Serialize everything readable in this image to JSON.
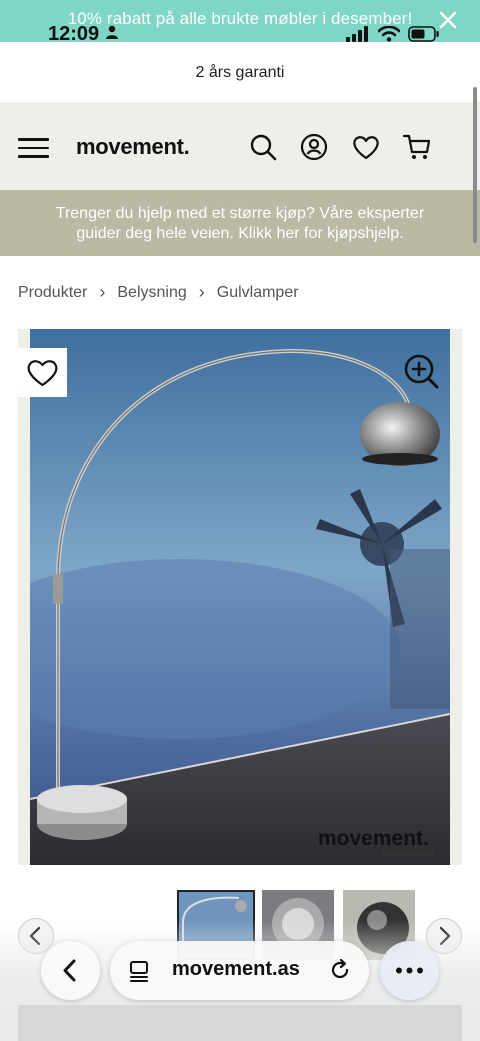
{
  "promo": {
    "text": "10% rabatt på alle brukte møbler i desember!"
  },
  "status": {
    "time": "12:09"
  },
  "topbar": {
    "garanti": "2 års garanti"
  },
  "header": {
    "logo": "movement."
  },
  "help": {
    "line1": "Trenger du hjelp med et større kjøp? Våre eksperter",
    "line2": "guider deg hele veien. Klikk her for kjøpshjelp."
  },
  "breadcrumb": {
    "items": [
      "Produkter",
      "Belysning",
      "Gulvlamper"
    ],
    "separator": "›"
  },
  "product_image": {
    "watermark": "movement."
  },
  "browser": {
    "url": "movement.as"
  },
  "colors": {
    "promo": "#7fd6c6",
    "header": "#eeeeea",
    "helpbar": "#b9b9a4"
  }
}
